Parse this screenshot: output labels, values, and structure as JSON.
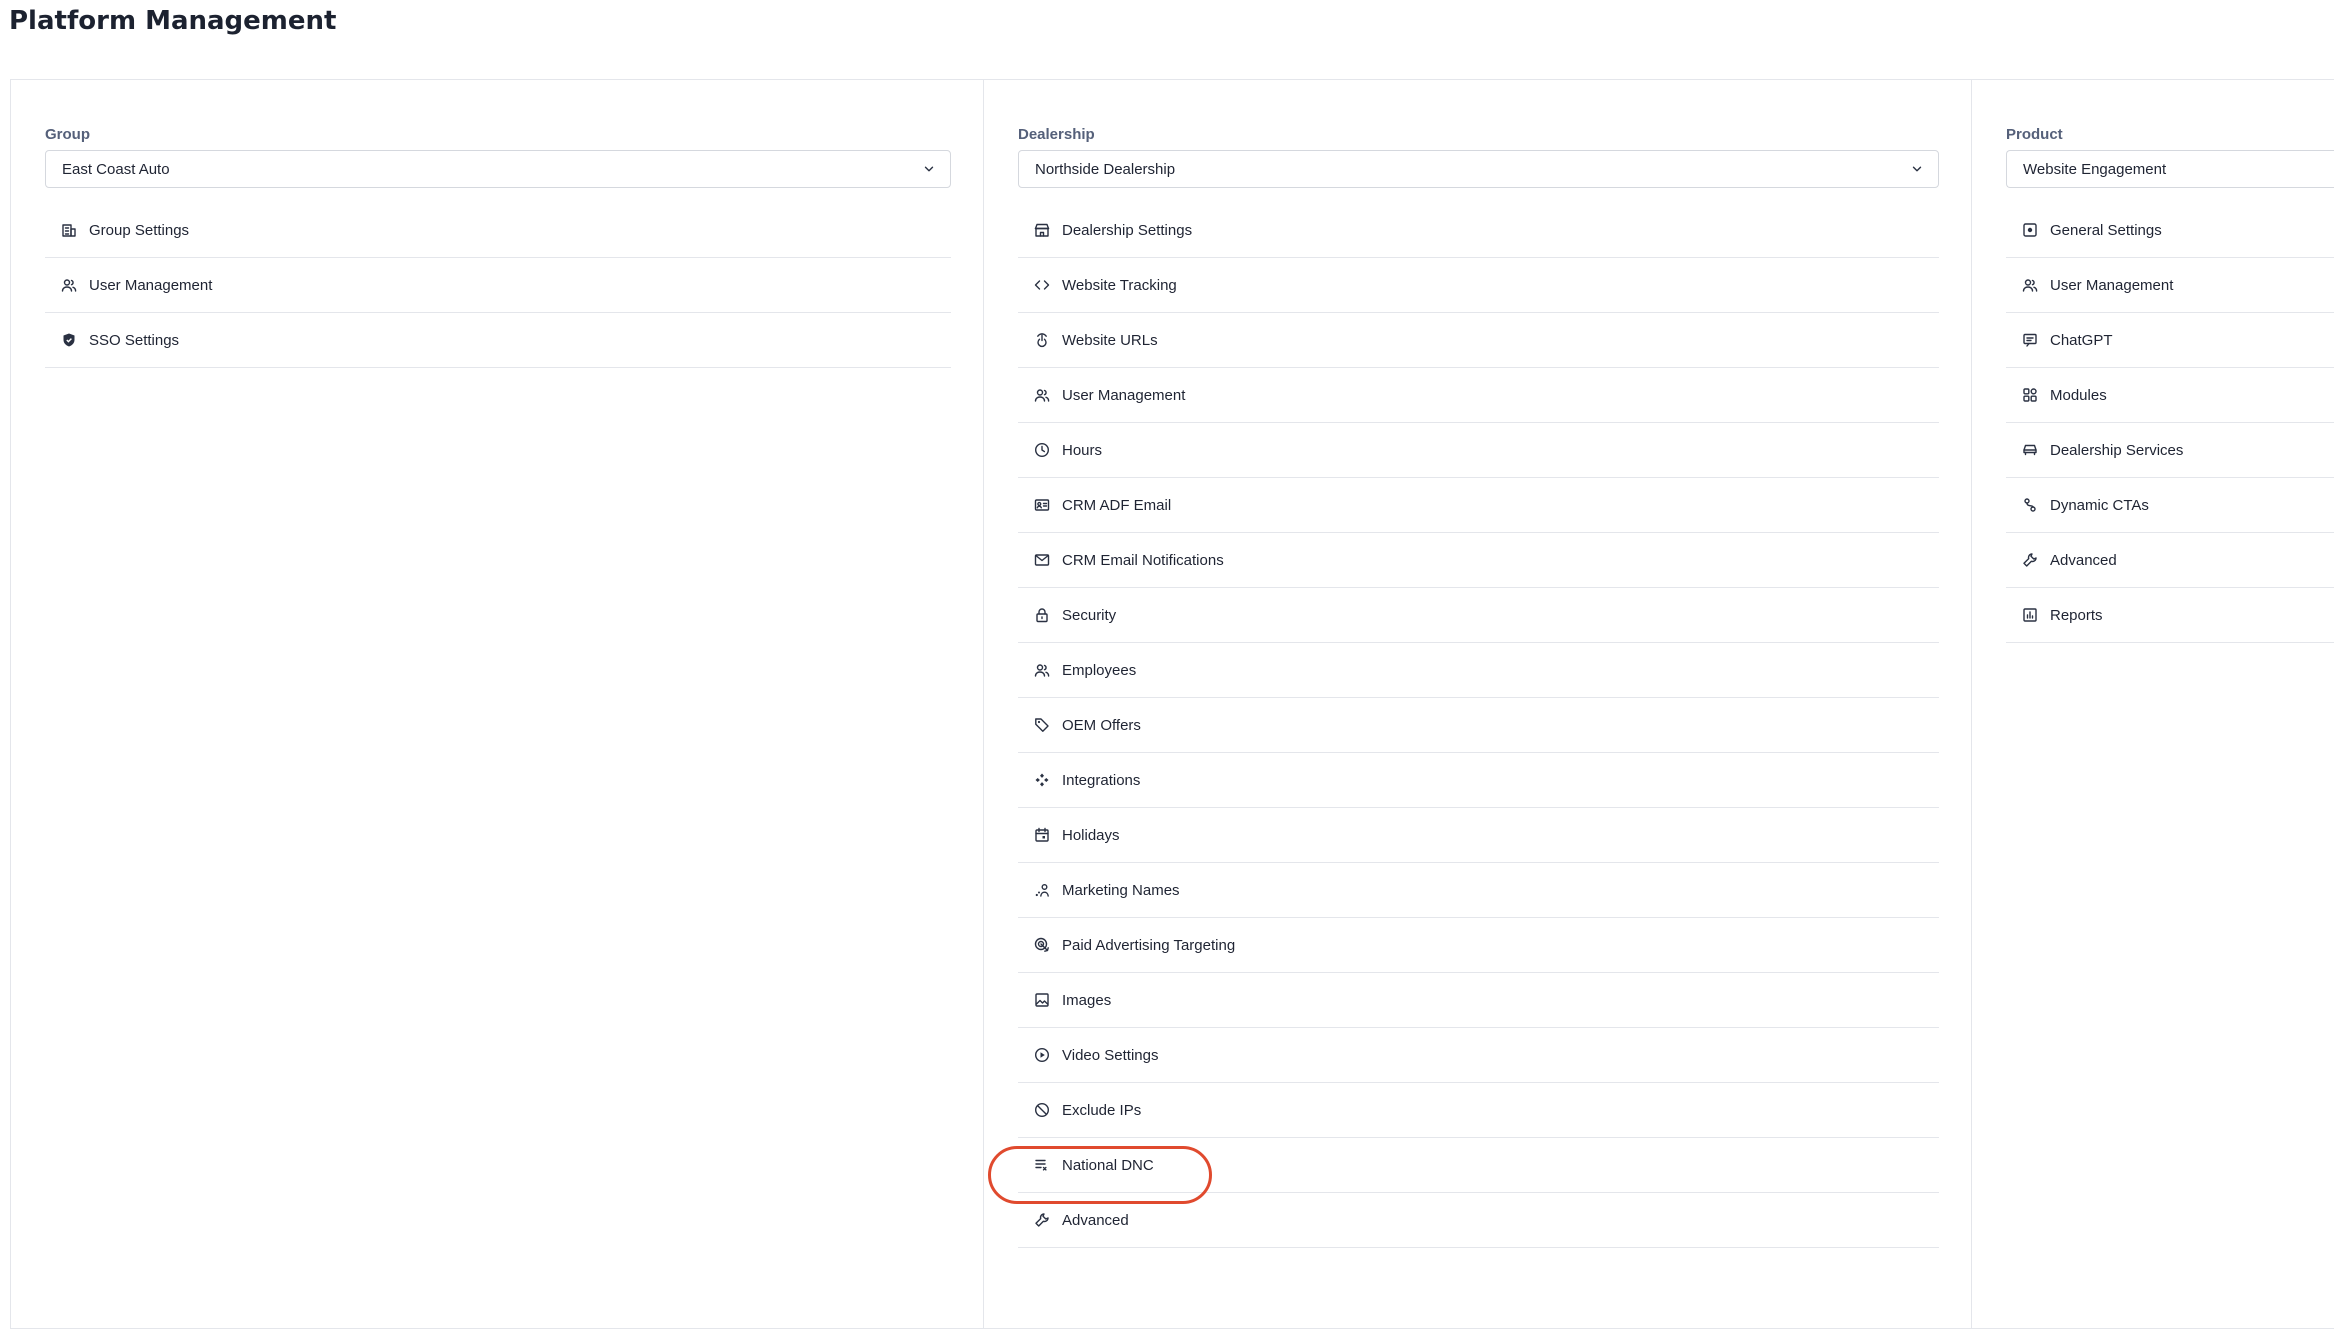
{
  "page": {
    "title": "Platform Management"
  },
  "group": {
    "label": "Group",
    "selected": "East Coast Auto",
    "items": [
      {
        "label": "Group Settings",
        "icon": "building-icon"
      },
      {
        "label": "User Management",
        "icon": "users-icon"
      },
      {
        "label": "SSO Settings",
        "icon": "shield-icon"
      }
    ]
  },
  "dealership": {
    "label": "Dealership",
    "selected": "Northside Dealership",
    "items": [
      {
        "label": "Dealership Settings",
        "icon": "store-icon"
      },
      {
        "label": "Website Tracking",
        "icon": "code-icon"
      },
      {
        "label": "Website URLs",
        "icon": "pointer-icon"
      },
      {
        "label": "User Management",
        "icon": "users-icon"
      },
      {
        "label": "Hours",
        "icon": "clock-icon"
      },
      {
        "label": "CRM ADF Email",
        "icon": "id-card-icon"
      },
      {
        "label": "CRM Email Notifications",
        "icon": "mail-icon"
      },
      {
        "label": "Security",
        "icon": "lock-icon"
      },
      {
        "label": "Employees",
        "icon": "users-icon"
      },
      {
        "label": "OEM Offers",
        "icon": "tag-icon"
      },
      {
        "label": "Integrations",
        "icon": "integration-icon"
      },
      {
        "label": "Holidays",
        "icon": "calendar-icon"
      },
      {
        "label": "Marketing Names",
        "icon": "marketing-icon"
      },
      {
        "label": "Paid Advertising Targeting",
        "icon": "target-icon"
      },
      {
        "label": "Images",
        "icon": "image-icon"
      },
      {
        "label": "Video Settings",
        "icon": "play-icon"
      },
      {
        "label": "Exclude IPs",
        "icon": "ban-icon"
      },
      {
        "label": "National DNC",
        "icon": "list-icon"
      },
      {
        "label": "Advanced",
        "icon": "wrench-icon"
      }
    ]
  },
  "product": {
    "label": "Product",
    "selected": "Website Engagement",
    "items": [
      {
        "label": "General Settings",
        "icon": "settings-square-icon"
      },
      {
        "label": "User Management",
        "icon": "users-icon"
      },
      {
        "label": "ChatGPT",
        "icon": "chat-icon"
      },
      {
        "label": "Modules",
        "icon": "grid-icon"
      },
      {
        "label": "Dealership Services",
        "icon": "car-icon"
      },
      {
        "label": "Dynamic CTAs",
        "icon": "route-icon"
      },
      {
        "label": "Advanced",
        "icon": "wrench-icon"
      },
      {
        "label": "Reports",
        "icon": "report-icon"
      }
    ]
  },
  "theme": {
    "highlight": "#e04a2e",
    "border": "#e4e6eb"
  }
}
